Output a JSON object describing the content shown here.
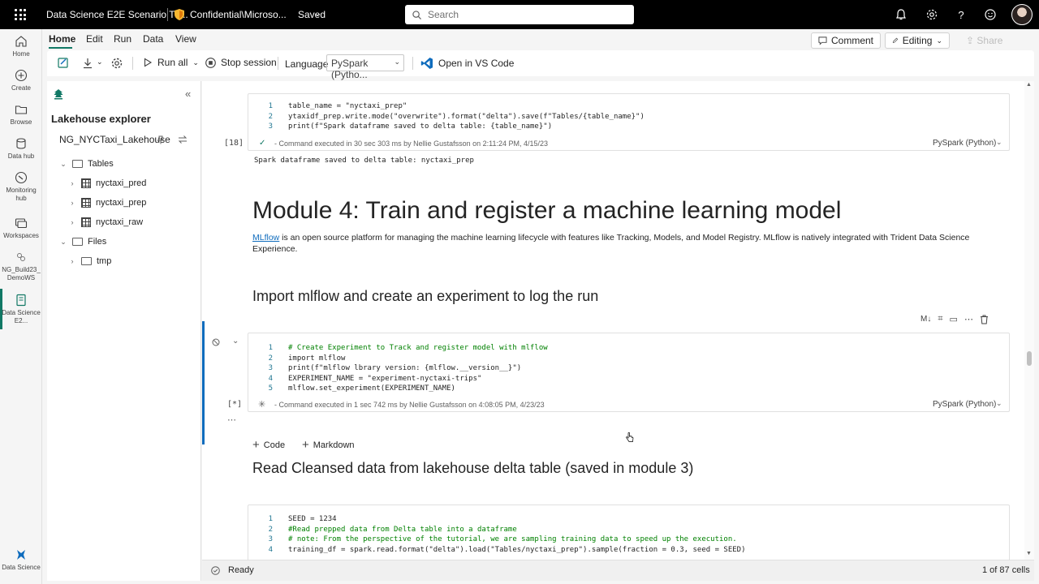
{
  "topbar": {
    "title": "Data Science E2E Scenario Tu...",
    "sensitivity": "Confidential\\Microso...",
    "saved": "Saved",
    "search_placeholder": "Search"
  },
  "leftrail": [
    {
      "label": "Home",
      "icon": "home-icon"
    },
    {
      "label": "Create",
      "icon": "plus-circle-icon"
    },
    {
      "label": "Browse",
      "icon": "folder-icon"
    },
    {
      "label": "Data hub",
      "icon": "database-icon"
    },
    {
      "label": "Monitoring hub",
      "icon": "monitor-icon"
    },
    {
      "label": "Workspaces",
      "icon": "workspaces-icon"
    },
    {
      "label": "NG_Build23_ DemoWS",
      "icon": "workspace-icon"
    },
    {
      "label": "Data Science E2...",
      "icon": "notebook-icon"
    },
    {
      "label": "Data Science",
      "icon": "data-science-icon"
    }
  ],
  "menu": {
    "tabs": [
      "Home",
      "Edit",
      "Run",
      "Data",
      "View"
    ],
    "comment": "Comment",
    "editing": "Editing",
    "share": "Share"
  },
  "toolbar": {
    "run_all": "Run all",
    "stop_session": "Stop session",
    "language_label": "Language",
    "language_value": "PySpark (Pytho...",
    "open_vscode": "Open in VS Code"
  },
  "explorer": {
    "title": "Lakehouse explorer",
    "lakehouse": "NG_NYCTaxi_Lakehouse",
    "tables_label": "Tables",
    "tables": [
      "nyctaxi_pred",
      "nyctaxi_prep",
      "nyctaxi_raw"
    ],
    "files_label": "Files",
    "files": [
      "tmp"
    ]
  },
  "cell18": {
    "exec": "[18]",
    "lines": [
      "table_name = \"nyctaxi_prep\"",
      "ytaxidf_prep.write.mode(\"overwrite\").format(\"delta\").save(f\"Tables/{table_name}\")",
      "print(f\"Spark dataframe saved to delta table: {table_name}\")"
    ],
    "status": "- Command executed in 30 sec 303 ms by Nellie Gustafsson on 2:11:24 PM, 4/15/23",
    "kernel": "PySpark (Python)",
    "output": "Spark dataframe saved to delta table: nyctaxi_prep"
  },
  "module4": {
    "heading": "Module 4: Train and register a machine learning model",
    "link": "MLflow",
    "paragraph": " is an open source platform for managing the machine learning lifecycle with features like Tracking, Models, and Model Registry. MLflow is natively integrated with Trident Data Science Experience.",
    "h2": "Import mlflow and create an experiment to log the run"
  },
  "cell_mlflow": {
    "exec": "[*]",
    "lines": [
      "# Create Experiment to Track and register model with mlflow",
      "import mlflow",
      "print(f\"mlflow lbrary version: {mlflow.__version__}\")",
      "EXPERIMENT_NAME = \"experiment-nyctaxi-trips\"",
      "mlflow.set_experiment(EXPERIMENT_NAME)"
    ],
    "status": "- Command executed in 1 sec 742 ms by Nellie Gustafsson on 4:08:05 PM, 4/23/23",
    "kernel": "PySpark (Python)"
  },
  "add": {
    "code": "Code",
    "markdown": "Markdown"
  },
  "h2_read": "Read Cleansed data from lakehouse delta table (saved in module 3)",
  "cell_read": {
    "lines": [
      "SEED = 1234",
      "#Read prepped data from Delta table into a dataframe",
      "# note: From the perspective of the tutorial, we are sampling training data to speed up the execution.",
      "training_df = spark.read.format(\"delta\").load(\"Tables/nyctaxi_prep\").sample(fraction = 0.3, seed = SEED)"
    ]
  },
  "status": {
    "state": "Ready",
    "cells": "1 of 87 cells"
  }
}
